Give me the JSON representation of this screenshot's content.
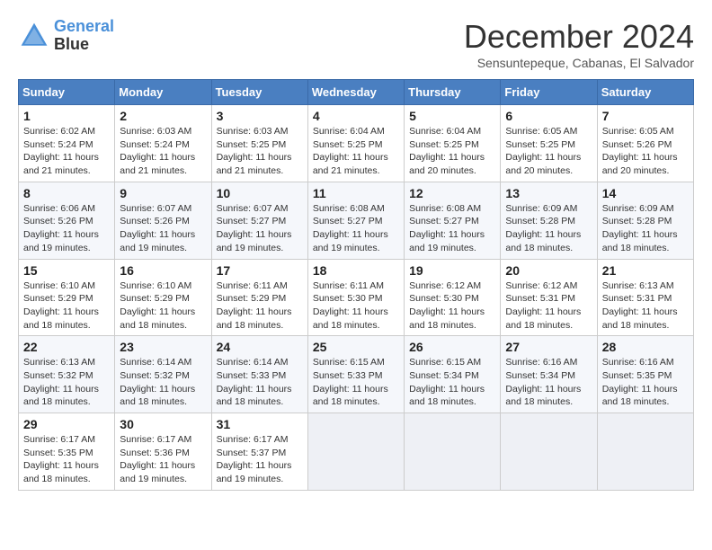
{
  "header": {
    "logo_line1": "General",
    "logo_line2": "Blue",
    "month": "December 2024",
    "location": "Sensuntepeque, Cabanas, El Salvador"
  },
  "weekdays": [
    "Sunday",
    "Monday",
    "Tuesday",
    "Wednesday",
    "Thursday",
    "Friday",
    "Saturday"
  ],
  "weeks": [
    [
      {
        "day": "1",
        "info": "Sunrise: 6:02 AM\nSunset: 5:24 PM\nDaylight: 11 hours\nand 21 minutes."
      },
      {
        "day": "2",
        "info": "Sunrise: 6:03 AM\nSunset: 5:24 PM\nDaylight: 11 hours\nand 21 minutes."
      },
      {
        "day": "3",
        "info": "Sunrise: 6:03 AM\nSunset: 5:25 PM\nDaylight: 11 hours\nand 21 minutes."
      },
      {
        "day": "4",
        "info": "Sunrise: 6:04 AM\nSunset: 5:25 PM\nDaylight: 11 hours\nand 21 minutes."
      },
      {
        "day": "5",
        "info": "Sunrise: 6:04 AM\nSunset: 5:25 PM\nDaylight: 11 hours\nand 20 minutes."
      },
      {
        "day": "6",
        "info": "Sunrise: 6:05 AM\nSunset: 5:25 PM\nDaylight: 11 hours\nand 20 minutes."
      },
      {
        "day": "7",
        "info": "Sunrise: 6:05 AM\nSunset: 5:26 PM\nDaylight: 11 hours\nand 20 minutes."
      }
    ],
    [
      {
        "day": "8",
        "info": "Sunrise: 6:06 AM\nSunset: 5:26 PM\nDaylight: 11 hours\nand 19 minutes."
      },
      {
        "day": "9",
        "info": "Sunrise: 6:07 AM\nSunset: 5:26 PM\nDaylight: 11 hours\nand 19 minutes."
      },
      {
        "day": "10",
        "info": "Sunrise: 6:07 AM\nSunset: 5:27 PM\nDaylight: 11 hours\nand 19 minutes."
      },
      {
        "day": "11",
        "info": "Sunrise: 6:08 AM\nSunset: 5:27 PM\nDaylight: 11 hours\nand 19 minutes."
      },
      {
        "day": "12",
        "info": "Sunrise: 6:08 AM\nSunset: 5:27 PM\nDaylight: 11 hours\nand 19 minutes."
      },
      {
        "day": "13",
        "info": "Sunrise: 6:09 AM\nSunset: 5:28 PM\nDaylight: 11 hours\nand 18 minutes."
      },
      {
        "day": "14",
        "info": "Sunrise: 6:09 AM\nSunset: 5:28 PM\nDaylight: 11 hours\nand 18 minutes."
      }
    ],
    [
      {
        "day": "15",
        "info": "Sunrise: 6:10 AM\nSunset: 5:29 PM\nDaylight: 11 hours\nand 18 minutes."
      },
      {
        "day": "16",
        "info": "Sunrise: 6:10 AM\nSunset: 5:29 PM\nDaylight: 11 hours\nand 18 minutes."
      },
      {
        "day": "17",
        "info": "Sunrise: 6:11 AM\nSunset: 5:29 PM\nDaylight: 11 hours\nand 18 minutes."
      },
      {
        "day": "18",
        "info": "Sunrise: 6:11 AM\nSunset: 5:30 PM\nDaylight: 11 hours\nand 18 minutes."
      },
      {
        "day": "19",
        "info": "Sunrise: 6:12 AM\nSunset: 5:30 PM\nDaylight: 11 hours\nand 18 minutes."
      },
      {
        "day": "20",
        "info": "Sunrise: 6:12 AM\nSunset: 5:31 PM\nDaylight: 11 hours\nand 18 minutes."
      },
      {
        "day": "21",
        "info": "Sunrise: 6:13 AM\nSunset: 5:31 PM\nDaylight: 11 hours\nand 18 minutes."
      }
    ],
    [
      {
        "day": "22",
        "info": "Sunrise: 6:13 AM\nSunset: 5:32 PM\nDaylight: 11 hours\nand 18 minutes."
      },
      {
        "day": "23",
        "info": "Sunrise: 6:14 AM\nSunset: 5:32 PM\nDaylight: 11 hours\nand 18 minutes."
      },
      {
        "day": "24",
        "info": "Sunrise: 6:14 AM\nSunset: 5:33 PM\nDaylight: 11 hours\nand 18 minutes."
      },
      {
        "day": "25",
        "info": "Sunrise: 6:15 AM\nSunset: 5:33 PM\nDaylight: 11 hours\nand 18 minutes."
      },
      {
        "day": "26",
        "info": "Sunrise: 6:15 AM\nSunset: 5:34 PM\nDaylight: 11 hours\nand 18 minutes."
      },
      {
        "day": "27",
        "info": "Sunrise: 6:16 AM\nSunset: 5:34 PM\nDaylight: 11 hours\nand 18 minutes."
      },
      {
        "day": "28",
        "info": "Sunrise: 6:16 AM\nSunset: 5:35 PM\nDaylight: 11 hours\nand 18 minutes."
      }
    ],
    [
      {
        "day": "29",
        "info": "Sunrise: 6:17 AM\nSunset: 5:35 PM\nDaylight: 11 hours\nand 18 minutes."
      },
      {
        "day": "30",
        "info": "Sunrise: 6:17 AM\nSunset: 5:36 PM\nDaylight: 11 hours\nand 19 minutes."
      },
      {
        "day": "31",
        "info": "Sunrise: 6:17 AM\nSunset: 5:37 PM\nDaylight: 11 hours\nand 19 minutes."
      },
      null,
      null,
      null,
      null
    ]
  ]
}
